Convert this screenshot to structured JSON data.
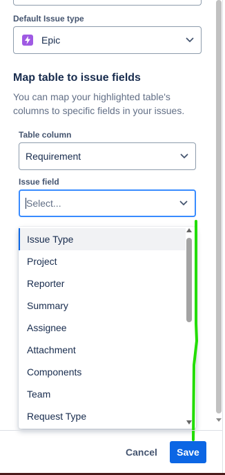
{
  "default_issue_type": {
    "label": "Default Issue type",
    "value": "Epic",
    "icon": "lightning-icon"
  },
  "mapping": {
    "title": "Map table to issue fields",
    "description": "You can map your highlighted table's columns to specific fields in your issues.",
    "table_column": {
      "label": "Table column",
      "value": "Requirement"
    },
    "issue_field": {
      "label": "Issue field",
      "placeholder": "Select..."
    }
  },
  "dropdown": {
    "options": [
      "Issue Type",
      "Project",
      "Reporter",
      "Summary",
      "Assignee",
      "Attachment",
      "Components",
      "Team",
      "Request Type"
    ],
    "highlighted_index": 0
  },
  "footer": {
    "cancel_label": "Cancel",
    "save_label": "Save"
  },
  "colors": {
    "primary": "#0c66e4",
    "focus": "#388bff",
    "epic": "#9f5ae3",
    "annotation": "#22dd00"
  }
}
